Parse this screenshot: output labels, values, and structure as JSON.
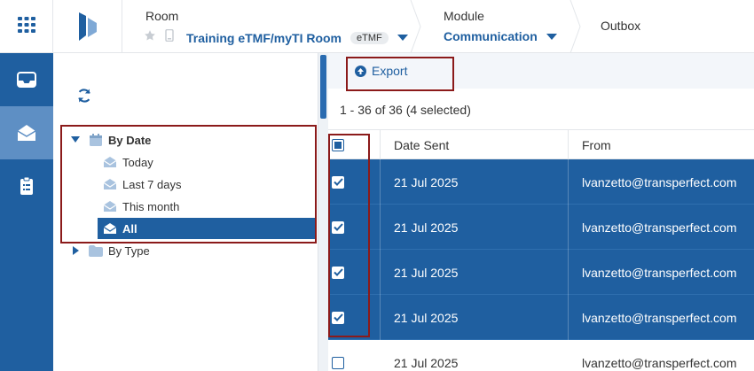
{
  "header": {
    "room": {
      "title": "Room",
      "name": "Training eTMF/myTI Room",
      "badge": "eTMF"
    },
    "module": {
      "title": "Module",
      "value": "Communication"
    },
    "current": "Outbox"
  },
  "tree": {
    "by_date": {
      "label": "By Date",
      "items": [
        {
          "label": "Today"
        },
        {
          "label": "Last 7 days"
        },
        {
          "label": "This month"
        },
        {
          "label": "All"
        }
      ]
    },
    "by_type": {
      "label": "By Type"
    }
  },
  "toolbar": {
    "export_label": "Export"
  },
  "list": {
    "count_text": "1 - 36 of 36 (4 selected)",
    "columns": {
      "date_sent": "Date Sent",
      "from": "From"
    },
    "rows": [
      {
        "date": "21 Jul 2025",
        "from": "lvanzetto@transperfect.com",
        "selected": true
      },
      {
        "date": "21 Jul 2025",
        "from": "lvanzetto@transperfect.com",
        "selected": true
      },
      {
        "date": "21 Jul 2025",
        "from": "lvanzetto@transperfect.com",
        "selected": true
      },
      {
        "date": "21 Jul 2025",
        "from": "lvanzetto@transperfect.com",
        "selected": true
      },
      {
        "date": "21 Jul 2025",
        "from": "lvanzetto@transperfect.com",
        "selected": false
      }
    ]
  },
  "colors": {
    "primary": "#1f5fa0",
    "rail_active": "#5e8fc4",
    "highlight_box": "#8b1a1a"
  }
}
